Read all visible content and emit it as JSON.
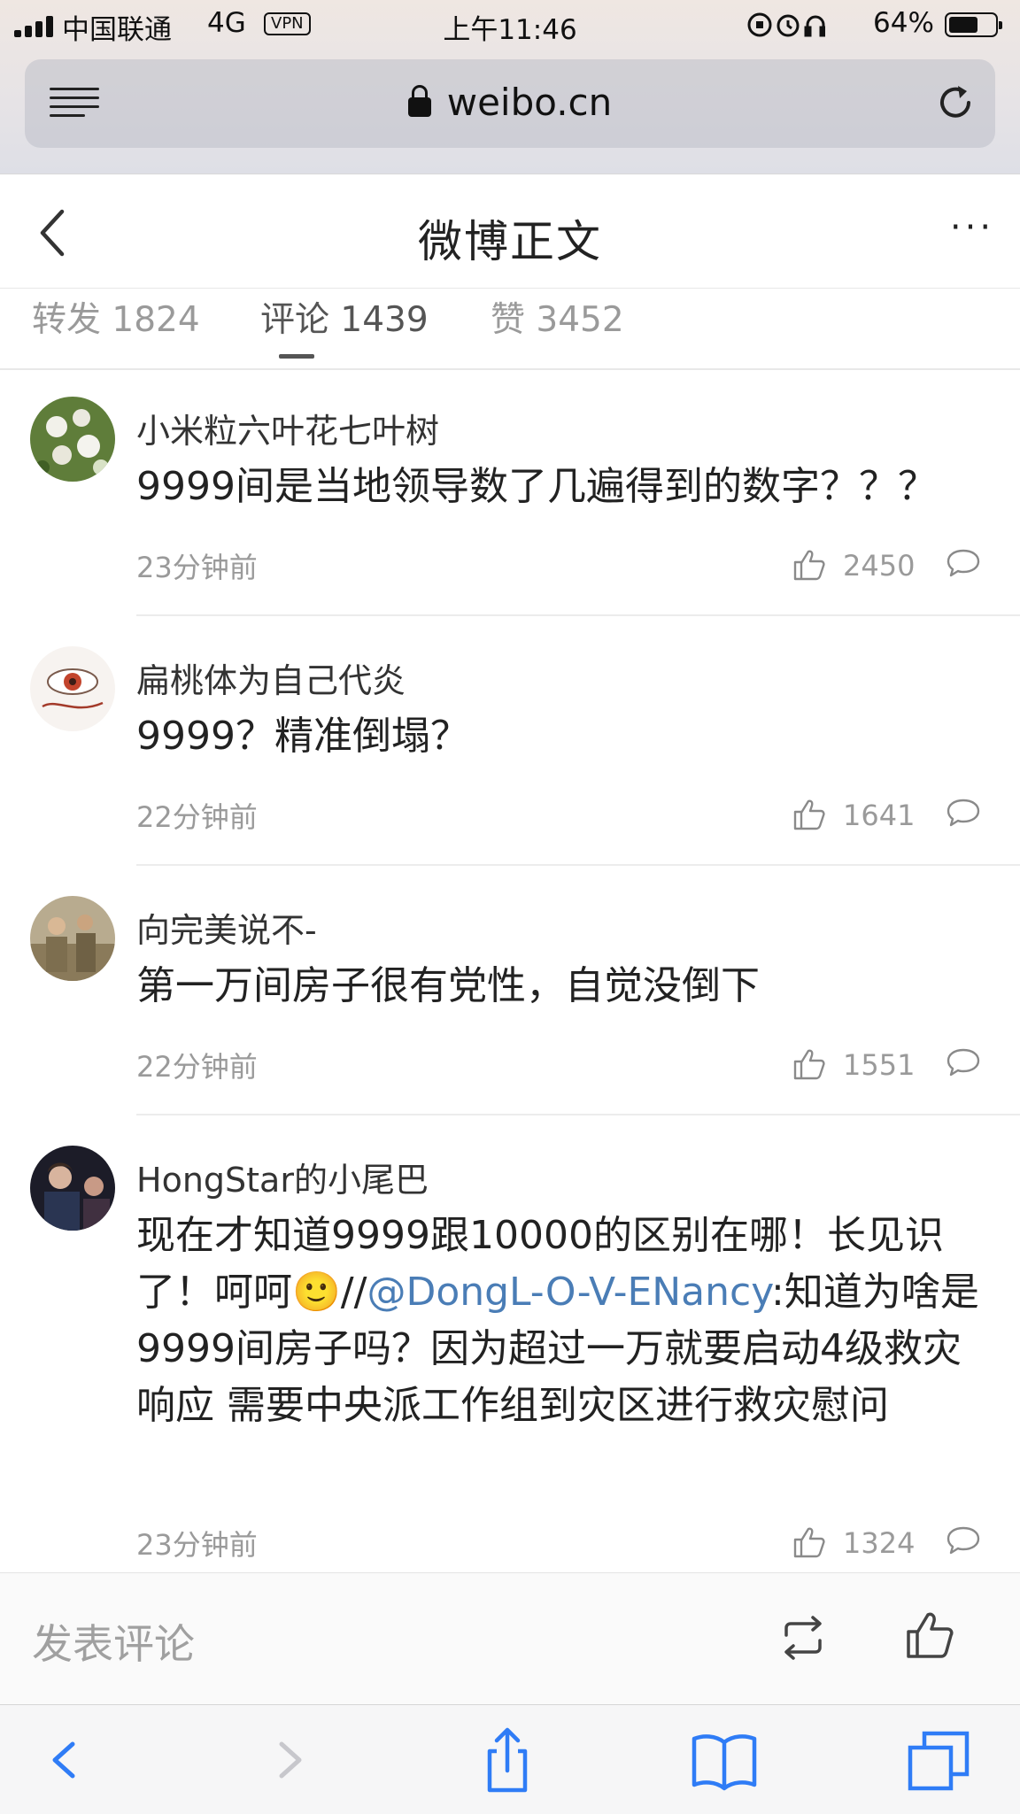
{
  "status_bar": {
    "carrier": "中国联通",
    "network": "4G",
    "vpn": "VPN",
    "time": "上午11:46",
    "battery_percent": "64%",
    "battery_level": 0.64
  },
  "address_bar": {
    "url": "weibo.cn"
  },
  "header": {
    "title": "微博正文"
  },
  "tabs": [
    {
      "label": "转发 1824",
      "active": false
    },
    {
      "label": "评论 1439",
      "active": true
    },
    {
      "label": "赞 3452",
      "active": false
    }
  ],
  "comments": [
    {
      "user": "小米粒六叶花七叶树",
      "text": "9999间是当地领导数了几遍得到的数字？？？",
      "time": "23分钟前",
      "likes": "2450"
    },
    {
      "user": "扁桃体为自己代炎",
      "text": "9999？精准倒塌？",
      "time": "22分钟前",
      "likes": "1641"
    },
    {
      "user": "向完美说不-",
      "text": "第一万间房子很有党性，自觉没倒下",
      "time": "22分钟前",
      "likes": "1551"
    },
    {
      "user": "HongStar的小尾巴",
      "text_before": "现在才知道9999跟10000的区别在哪！长见识了！呵呵🙂//",
      "mention": "@DongL-O-V-ENancy",
      "text_after": ":知道为啥是9999间房子吗？因为超过一万就要启动4级救灾响应 需要中央派工作组到灾区进行救灾慰问",
      "time": "23分钟前",
      "likes": "1324"
    }
  ],
  "compose": {
    "placeholder": "发表评论"
  },
  "colors": {
    "link": "#4a7db6",
    "safari_blue": "#2f7cf6",
    "muted_text": "#9a9a9a"
  },
  "icons": {
    "reply": "speech-bubble-icon",
    "like": "thumbs-up-icon",
    "repost": "repost-icon"
  }
}
